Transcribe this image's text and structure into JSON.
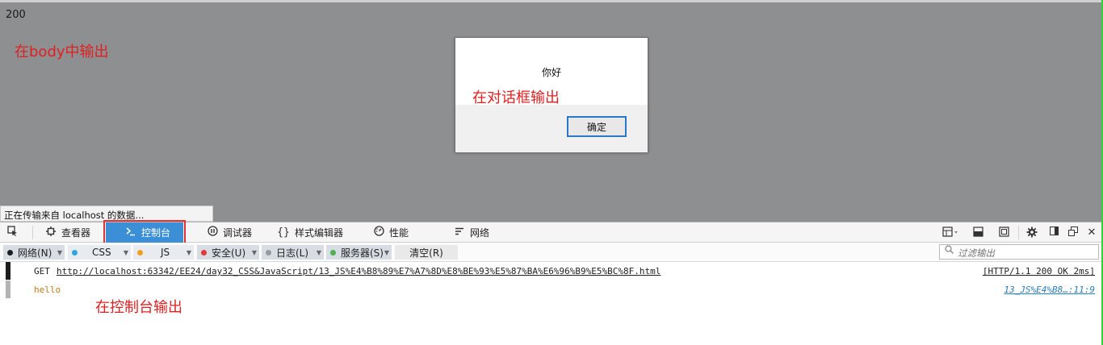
{
  "page": {
    "body_output": "200",
    "annotations": {
      "body": "在body中输出",
      "dialog": "在对话框输出",
      "console": "在控制台输出"
    }
  },
  "dialog": {
    "message": "你好",
    "ok_label": "确定"
  },
  "status_bar": {
    "text": "正在传输来自 localhost 的数据..."
  },
  "devtools": {
    "tabs": [
      {
        "label": "查看器",
        "icon": "inspector-icon"
      },
      {
        "label": "控制台",
        "icon": "console-icon",
        "selected": true
      },
      {
        "label": "调试器",
        "icon": "debugger-icon"
      },
      {
        "label": "样式编辑器",
        "icon": "style-editor-icon"
      },
      {
        "label": "性能",
        "icon": "performance-icon"
      },
      {
        "label": "网络",
        "icon": "network-icon"
      }
    ],
    "right_icons": [
      "split-console-icon",
      "scratchpad-icon",
      "responsive-icon",
      "settings-icon",
      "dock-side-icon",
      "undock-icon",
      "close-icon"
    ],
    "accent_color": "#3b8fd6"
  },
  "filters": {
    "buttons": [
      {
        "label": "网络(N)",
        "dot": "#1d1d1d"
      },
      {
        "label": "CSS",
        "dot": "#2da6df"
      },
      {
        "label": "JS",
        "dot": "#f0a020"
      },
      {
        "label": "安全(U)",
        "dot": "#e03a3a"
      },
      {
        "label": "日志(L)",
        "dot": "#9a9a9a"
      },
      {
        "label": "服务器(S)",
        "dot": "#4caf50"
      }
    ],
    "clear_label": "清空(R)",
    "search_placeholder": "过滤输出"
  },
  "console": {
    "rows": [
      {
        "method": "GET",
        "url": "http://localhost:63342/EE24/day32_CSS&JavaScript/13_JS%E4%B8%89%E7%A7%8D%E8%BE%93%E5%87%BA%E6%96%B9%E5%BC%8F.html",
        "status": "[HTTP/1.1 200 OK 2ms]"
      },
      {
        "message": "hello",
        "source": "13_JS%E4%B8…:11:9"
      }
    ]
  }
}
